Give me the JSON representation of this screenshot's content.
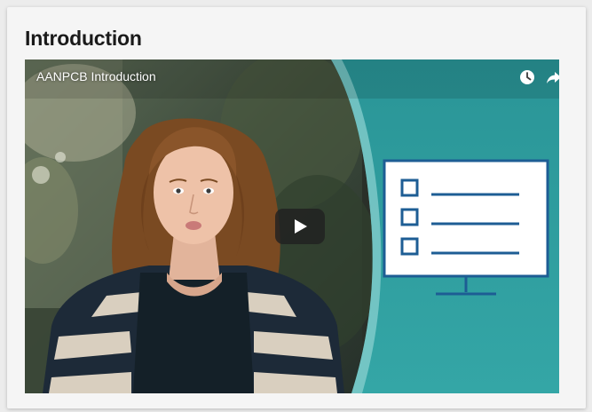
{
  "section": {
    "title": "Introduction"
  },
  "video": {
    "title": "AANPCB Introduction",
    "icons": {
      "watch_later": "clock-icon",
      "share": "share-icon",
      "play": "play-icon"
    },
    "colors": {
      "teal": "#2f9ea0",
      "accent_blue": "#1d5d94",
      "player_button": "#212121"
    }
  }
}
